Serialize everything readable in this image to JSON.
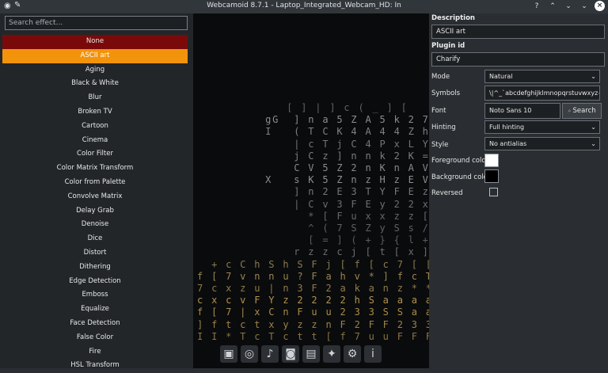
{
  "window": {
    "title": "Webcamoid 8.7.1 - Laptop_Integrated_Webcam_HD: In",
    "app_icon": "webcam-icon",
    "pin_icon": "pin-icon",
    "controls": [
      "help-icon",
      "keep-above-icon",
      "keep-below-icon",
      "minimize-icon",
      "close-icon"
    ]
  },
  "effects": {
    "search_placeholder": "Search effect...",
    "items": [
      "None",
      "ASCII art",
      "Aging",
      "Black & White",
      "Blur",
      "Broken TV",
      "Cartoon",
      "Cinema",
      "Color Filter",
      "Color Matrix Transform",
      "Color from Palette",
      "Convolve Matrix",
      "Delay Grab",
      "Denoise",
      "Dice",
      "Distort",
      "Dithering",
      "Edge Detection",
      "Emboss",
      "Equalize",
      "Face Detection",
      "False Color",
      "Fire",
      "HSL Transform"
    ],
    "selected": "ASCII art"
  },
  "preview": {
    "ascii_lines": [
      {
        "text": "        [ ] | ] c ( _ ] [",
        "color": "#5f6366"
      },
      {
        "text": "     gG  ] n a 5 Z A 5 k 2 7 -  /",
        "color": "#8a8d90"
      },
      {
        "text": "     I   ( T C K 4 A 4 4 Z h s )",
        "color": "#7f8284"
      },
      {
        "text": "         | c T j C 4 P x L Y c )",
        "color": "#73767a"
      },
      {
        "text": "         j C z ] n n k 2 K = Y ]",
        "color": "#7b7e82"
      },
      {
        "text": "         C V 5 Z 2 n K n A V 5 F (",
        "color": "#878a8d"
      },
      {
        "text": "     X   s K 5 Z n z H z E V K C ^",
        "color": "#8d9093"
      },
      {
        "text": "         ] n 2 E 3 T Y F E z x [",
        "color": "#75787b"
      },
      {
        "text": "         | C v 3 F E y 2 2 x v )",
        "color": "#6c6f72"
      },
      {
        "text": "           * [ F u x x z z [ Y",
        "color": "#65686b"
      },
      {
        "text": "           ^ ( 7 S Z y S s / <",
        "color": "#5f6265"
      },
      {
        "text": "           [ = ] ( + } { l +",
        "color": "#5a5d60"
      },
      {
        "text": "         r z z c j [ t [ x ] f I ( / ) )",
        "color": "#6b6e71"
      },
      {
        "text": "   + c C h S h S F j [ f [ c 7 [ [ f = [ u x T",
        "color": "#8a7a52"
      },
      {
        "text": " f [ 7 v n n u ? F a h v * ] f c T f Y ? ) 2 F 7 C C ]",
        "color": "#9a8654"
      },
      {
        "text": " 7 c x z u | n 3 F 2 a k a n z * * * [ F z S k S S u n x c",
        "color": "#8e7b4e"
      },
      {
        "text": " c x c v F Y z 2 2 2 2 h S a a a a S a a k V V a a S h 2 x x",
        "color": "#b29450"
      },
      {
        "text": " f [ 7 | x C n F u u 2 3 3 S S a a a a a a k a k a h h 2",
        "color": "#a98c4c"
      },
      {
        "text": " ] f t c t x y z z n F 2 F F 2 3 3 h 3 3 2 h h 3 F 2 2 c",
        "color": "#9c8249"
      },
      {
        "text": " I I * T c T c t t [ f 7 u u F F F F h 2 3 2 n n 2 F z f",
        "color": "#8a7443"
      }
    ],
    "toolbar": [
      "image-icon",
      "webcam-icon",
      "music-icon",
      "camera-icon",
      "film-icon",
      "effects-icon",
      "settings-icon",
      "info-icon"
    ]
  },
  "panel": {
    "description_label": "Description",
    "description_value": "ASCII art",
    "plugin_id_label": "Plugin id",
    "plugin_id_value": "Charify",
    "mode_label": "Mode",
    "mode_value": "Natural",
    "symbols_label": "Symbols",
    "symbols_value": "\\|^_`abcdefghijklmnopqrstuvwxyz{|}~",
    "font_label": "Font",
    "font_value": "Noto Sans 10",
    "search_button": "Search",
    "hinting_label": "Hinting",
    "hinting_value": "Full hinting",
    "style_label": "Style",
    "style_value": "No antialias",
    "fg_label": "Foreground color",
    "fg_color": "#ffffff",
    "bg_label": "Background color",
    "bg_color": "#000000",
    "reversed_label": "Reversed",
    "reversed_checked": false
  },
  "colors": {
    "none_item_bg": "#7a0a0a",
    "selected_item_bg": "#f2930c",
    "window_bg": "#2a2e32"
  }
}
